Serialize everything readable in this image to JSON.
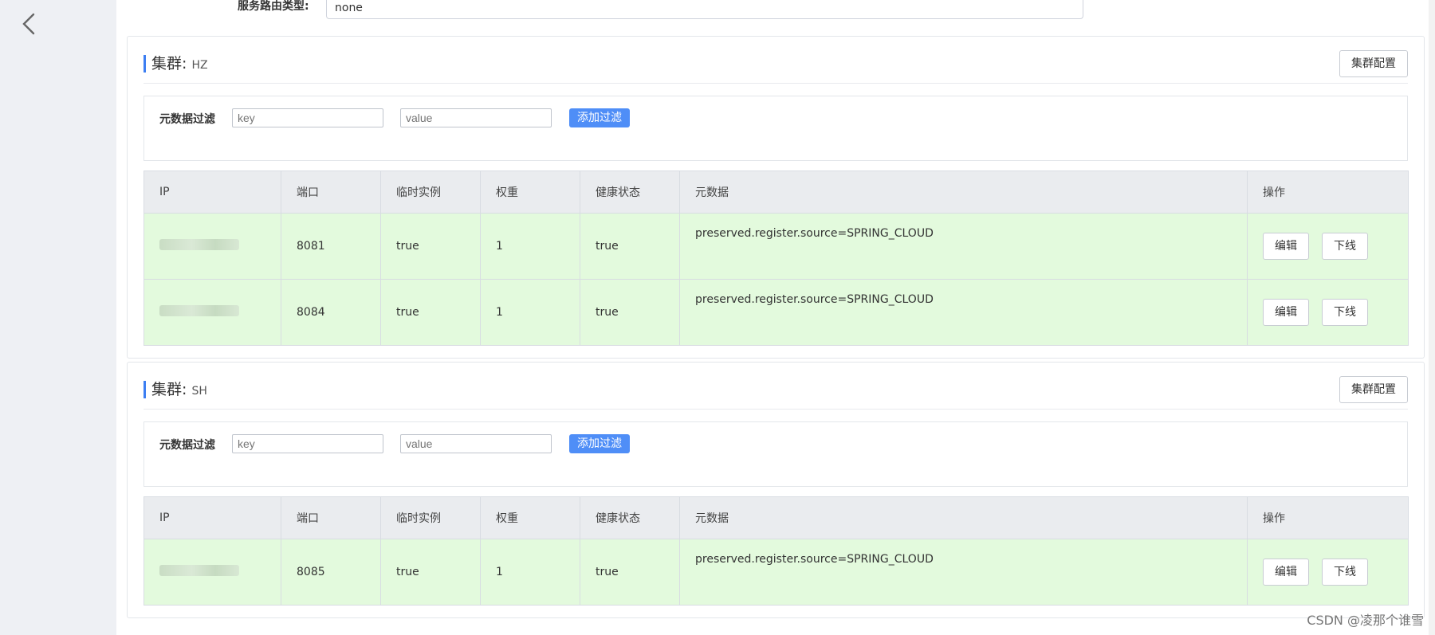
{
  "route": {
    "label": "服务路由类型:",
    "value": "none"
  },
  "clusters": [
    {
      "title": "集群:",
      "name": "HZ",
      "config_button": "集群配置",
      "filter": {
        "label": "元数据过滤",
        "key_placeholder": "key",
        "value_placeholder": "value",
        "add_button": "添加过滤"
      },
      "columns": [
        "IP",
        "端口",
        "临时实例",
        "权重",
        "健康状态",
        "元数据",
        "操作"
      ],
      "rows": [
        {
          "port": "8081",
          "ephemeral": "true",
          "weight": "1",
          "healthy": "true",
          "metadata": "preserved.register.source=SPRING_CLOUD",
          "edit": "编辑",
          "offline": "下线"
        },
        {
          "port": "8084",
          "ephemeral": "true",
          "weight": "1",
          "healthy": "true",
          "metadata": "preserved.register.source=SPRING_CLOUD",
          "edit": "编辑",
          "offline": "下线"
        }
      ]
    },
    {
      "title": "集群:",
      "name": "SH",
      "config_button": "集群配置",
      "filter": {
        "label": "元数据过滤",
        "key_placeholder": "key",
        "value_placeholder": "value",
        "add_button": "添加过滤"
      },
      "columns": [
        "IP",
        "端口",
        "临时实例",
        "权重",
        "健康状态",
        "元数据",
        "操作"
      ],
      "rows": [
        {
          "port": "8085",
          "ephemeral": "true",
          "weight": "1",
          "healthy": "true",
          "metadata": "preserved.register.source=SPRING_CLOUD",
          "edit": "编辑",
          "offline": "下线"
        }
      ]
    }
  ],
  "watermark": "CSDN @凌那个谁雪",
  "colors": {
    "accent": "#4f8ef7",
    "row_bg": "#e3fadd",
    "header_bg": "#eaecef",
    "sidebar_bg": "#eef0f4"
  }
}
